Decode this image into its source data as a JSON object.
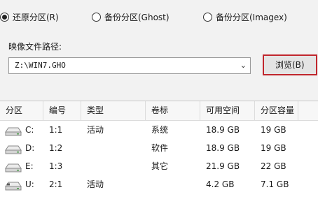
{
  "mode_options": [
    {
      "label": "还原分区(R)",
      "checked": true
    },
    {
      "label": "备份分区(Ghost)",
      "checked": false
    },
    {
      "label": "备份分区(Imagex)",
      "checked": false
    }
  ],
  "image_path": {
    "label": "映像文件路径:",
    "value": "Z:\\WIN7.GHO"
  },
  "browse_button": "浏览(B)",
  "partition_table": {
    "columns": [
      "分区",
      "编号",
      "类型",
      "卷标",
      "可用空间",
      "分区容量"
    ],
    "rows": [
      {
        "drive": "C:",
        "number": "1:1",
        "type": "活动",
        "label": "系统",
        "free": "18.9 GB",
        "size": "19 GB",
        "icon": "hard-drive-icon"
      },
      {
        "drive": "D:",
        "number": "1:2",
        "type": "",
        "label": "软件",
        "free": "18.9 GB",
        "size": "19 GB",
        "icon": "hard-drive-icon"
      },
      {
        "drive": "E:",
        "number": "1:3",
        "type": "",
        "label": "其它",
        "free": "21.9 GB",
        "size": "22 GB",
        "icon": "hard-drive-icon"
      },
      {
        "drive": "U:",
        "number": "2:1",
        "type": "活动",
        "label": "",
        "free": "4.2 GB",
        "size": "7.1 GB",
        "icon": "usb-drive-icon"
      }
    ]
  }
}
